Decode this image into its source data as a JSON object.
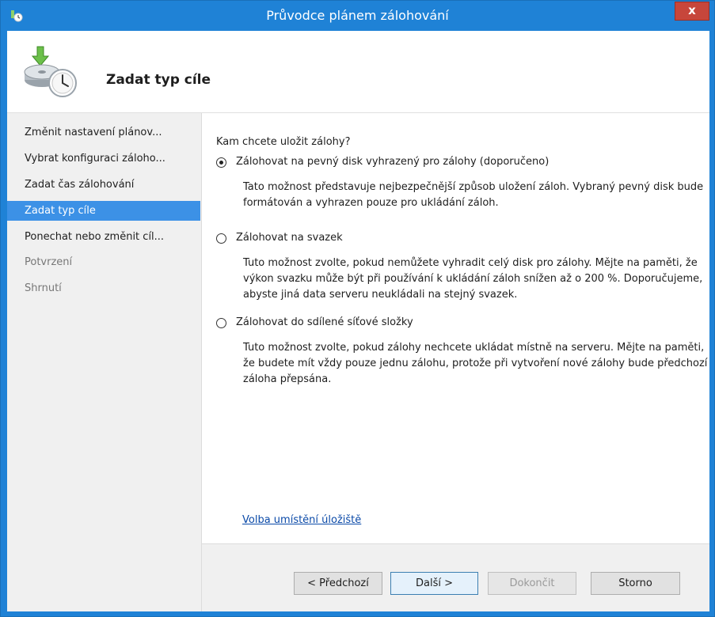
{
  "window": {
    "title": "Průvodce plánem zálohování",
    "close_label": "x"
  },
  "header": {
    "page_title": "Zadat typ cíle"
  },
  "sidebar": {
    "items": [
      {
        "label": "Změnit nastavení plánov...",
        "state": "normal"
      },
      {
        "label": "Vybrat konfiguraci záloho...",
        "state": "normal"
      },
      {
        "label": "Zadat čas zálohování",
        "state": "normal"
      },
      {
        "label": "Zadat typ cíle",
        "state": "active"
      },
      {
        "label": "Ponechat nebo změnit cíl...",
        "state": "normal"
      },
      {
        "label": "Potvrzení",
        "state": "disabled"
      },
      {
        "label": "Shrnutí",
        "state": "disabled"
      }
    ]
  },
  "main": {
    "question": "Kam chcete uložit zálohy?",
    "options": [
      {
        "label": "Zálohovat na pevný disk vyhrazený pro zálohy (doporučeno)",
        "description": "Tato možnost představuje nejbezpečnější způsob uložení záloh. Vybraný pevný disk bude formátován a vyhrazen pouze pro ukládání záloh.",
        "checked": true
      },
      {
        "label": "Zálohovat na svazek",
        "description": "Tuto možnost zvolte, pokud nemůžete vyhradit celý disk pro zálohy. Mějte na paměti, že výkon svazku může být při používání k ukládání záloh snížen až o 200 %. Doporučujeme, abyste jiná data serveru neukládali na stejný svazek.",
        "checked": false
      },
      {
        "label": "Zálohovat do sdílené síťové složky",
        "description": "Tuto možnost zvolte, pokud zálohy nechcete ukládat místně na serveru. Mějte na paměti, že budete mít vždy pouze jednu zálohu, protože při vytvoření nové zálohy bude předchozí záloha přepsána.",
        "checked": false
      }
    ],
    "storage_link": "Volba umístění úložiště"
  },
  "footer": {
    "back_label": "< Předchozí",
    "next_label": "Další >",
    "finish_label": "Dokončit",
    "cancel_label": "Storno"
  },
  "colors": {
    "titlebar": "#1f82d6",
    "selection": "#3c91e6",
    "link": "#0b4aa8",
    "close": "#c7463b"
  }
}
